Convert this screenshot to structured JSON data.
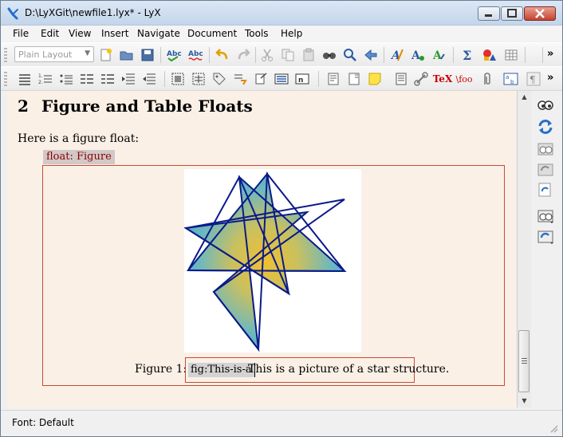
{
  "window": {
    "title": "D:\\LyXGit\\newfile1.lyx* - LyX"
  },
  "menubar": {
    "items": [
      "File",
      "Edit",
      "View",
      "Insert",
      "Navigate",
      "Document",
      "Tools",
      "Help"
    ]
  },
  "toolbar1": {
    "layout_combo": "Plain Layout",
    "icons": [
      "new-file-icon",
      "open-file-icon",
      "save-icon",
      "spellcheck-icon",
      "continuous-spellcheck-icon",
      "undo-icon",
      "redo-icon",
      "cut-icon",
      "copy-icon",
      "paste-icon",
      "find-icon",
      "find-replace-icon",
      "back-icon",
      "text-style-icon",
      "apply-style-icon",
      "math-icon",
      "insert-graphics-icon",
      "insert-table-icon"
    ],
    "overflow_label": "»"
  },
  "toolbar2": {
    "icons": [
      "itemize-icon",
      "enumerate-icon",
      "description-icon",
      "decrease-depth-icon",
      "increase-depth-icon",
      "indent-icon",
      "outdent-icon",
      "figure-float-icon",
      "table-float-icon",
      "label-icon",
      "cross-reference-icon",
      "citation-icon",
      "index-icon",
      "nomenclature-icon",
      "footnote-icon",
      "margin-note-icon",
      "note-icon",
      "box-icon",
      "hyperlink-icon",
      "tex-code-icon",
      "include-icon",
      "attach-icon",
      "math-macro-icon",
      "paragraph-settings-icon"
    ],
    "tex_label": "TeX",
    "foo_label": "\\foo",
    "overflow_label": "»"
  },
  "document": {
    "section_number": "2",
    "section_title": "Figure and Table Floats",
    "paragraph": "Here is a figure float:",
    "float_label": "float: Figure",
    "caption_prefix": "Figure 1:",
    "caption_label": "fig:This-is-a",
    "caption_text": "This is a picture of a star structure.",
    "image_description": "nine-pointed star figure with yellow-teal gradient"
  },
  "sidebar": {
    "icons": [
      "view-icon",
      "update-icon",
      "view-other-icon",
      "update-other-icon",
      "export-icon",
      "view-master-icon",
      "update-master-icon"
    ]
  },
  "statusbar": {
    "text": "Font: Default"
  },
  "colors": {
    "document_bg": "#faf0e6",
    "float_border": "#c74a3a",
    "float_label_text": "#8b0000",
    "star_stroke": "#0a1a8a",
    "star_fill_center": "#f0c030",
    "star_fill_edge": "#5cb4c8"
  }
}
